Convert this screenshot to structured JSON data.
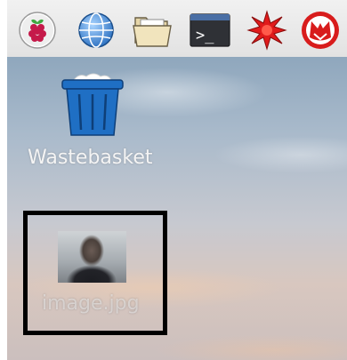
{
  "taskbar": {
    "items": [
      {
        "name": "raspberry-menu",
        "icon": "raspberry-icon"
      },
      {
        "name": "web-browser",
        "icon": "globe-icon"
      },
      {
        "name": "file-manager",
        "icon": "folder-icon"
      },
      {
        "name": "terminal",
        "icon": "terminal-icon"
      },
      {
        "name": "mathematica",
        "icon": "star-burst-icon"
      },
      {
        "name": "wolfram",
        "icon": "wolf-icon"
      }
    ],
    "terminal_prompt": ">_"
  },
  "desktop": {
    "icons": [
      {
        "label": "Wastebasket",
        "icon": "trash-icon"
      },
      {
        "label": "image.jpg",
        "icon": "image-thumbnail",
        "selected": true
      }
    ]
  },
  "colors": {
    "highlight_border": "#000000",
    "trash_blue": "#1f6fc4",
    "wolfram_red": "#d81c1c"
  }
}
